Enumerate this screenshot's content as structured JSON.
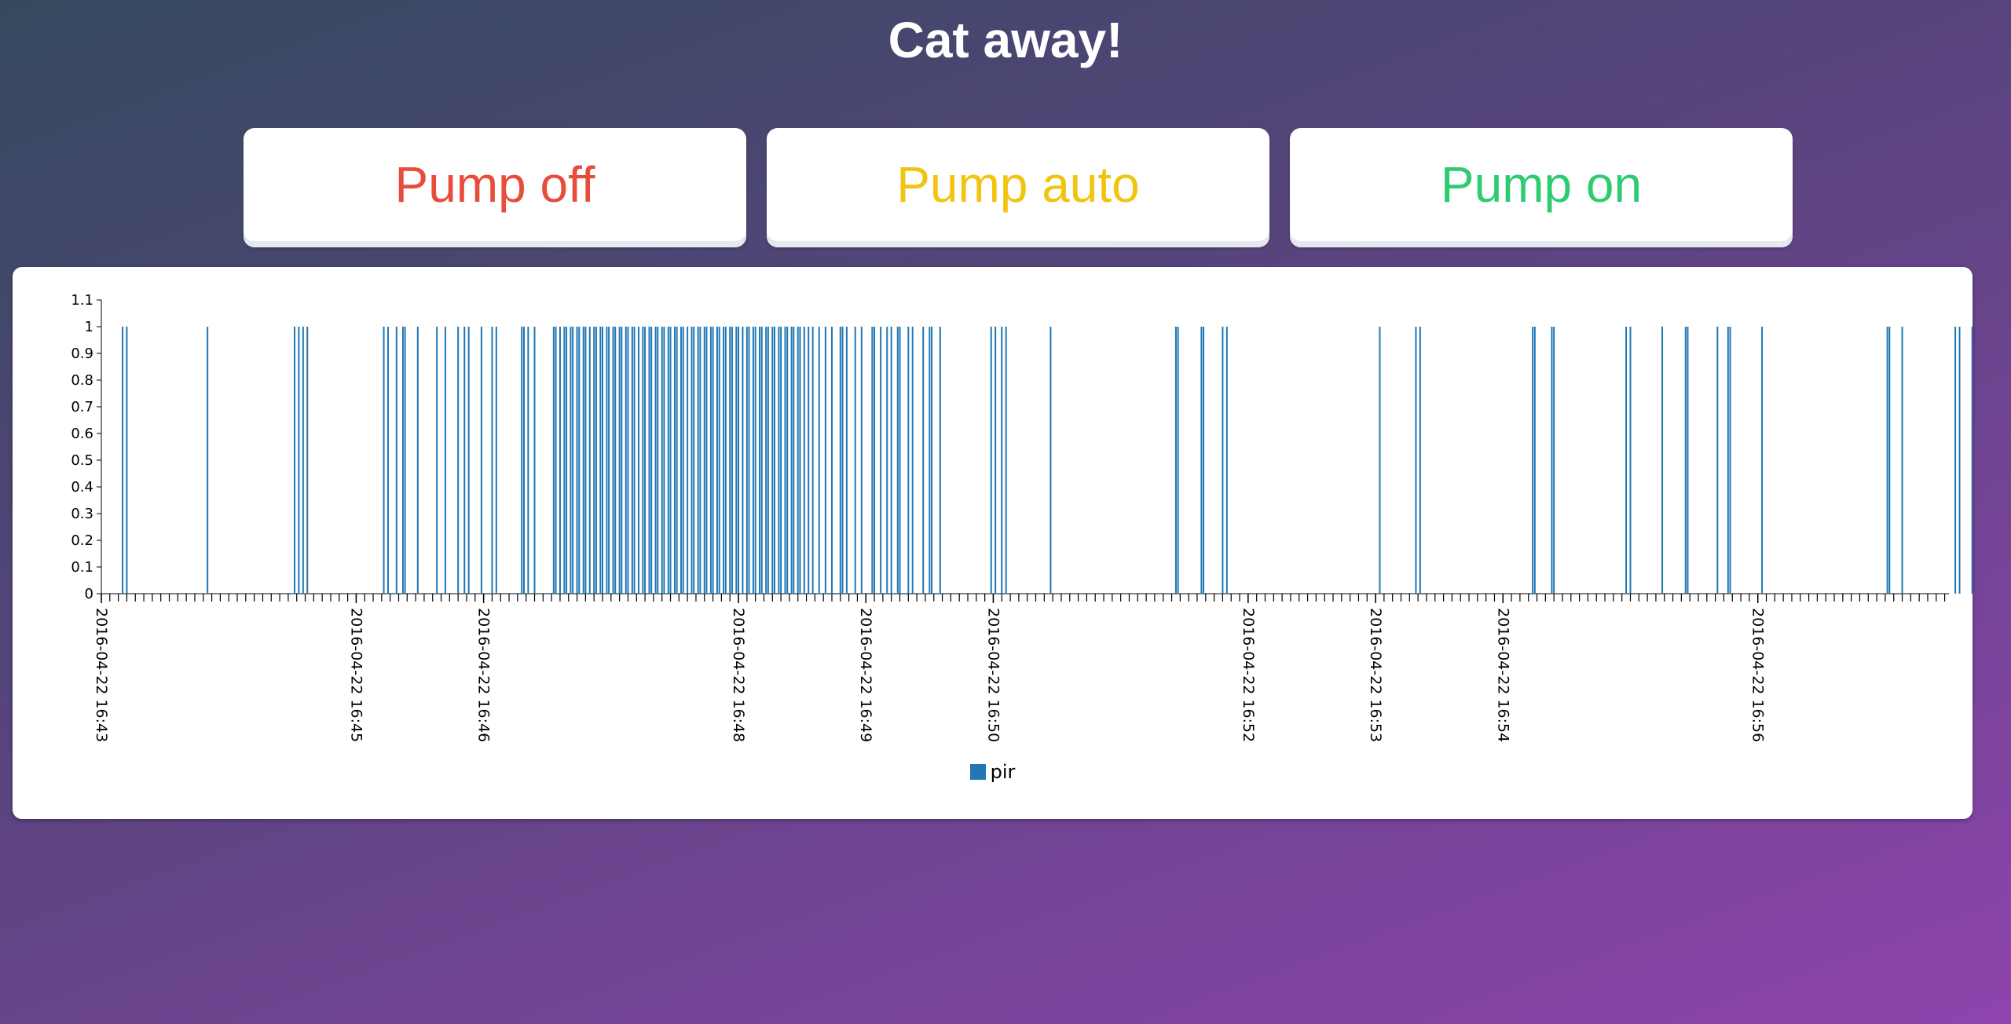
{
  "page": {
    "title": "Cat away!"
  },
  "buttons": [
    {
      "label": "Pump off",
      "color": "#e74c3c"
    },
    {
      "label": "Pump auto",
      "color": "#f1c40f"
    },
    {
      "label": "Pump on",
      "color": "#2ecc71"
    }
  ],
  "chart_data": {
    "type": "bar",
    "title": "",
    "xlabel": "",
    "ylabel": "",
    "ylim": [
      0,
      1.1
    ],
    "y_ticks": [
      0,
      0.1,
      0.2,
      0.3,
      0.4,
      0.5,
      0.6,
      0.7,
      0.8,
      0.9,
      1,
      1.1
    ],
    "x_tick_labels": [
      "2016-04-22 16:43",
      "2016-04-22 16:45",
      "2016-04-22 16:46",
      "2016-04-22 16:48",
      "2016-04-22 16:49",
      "2016-04-22 16:50",
      "2016-04-22 16:52",
      "2016-04-22 16:53",
      "2016-04-22 16:54",
      "2016-04-22 16:56"
    ],
    "x_tick_times": [
      "16:43:00",
      "16:45:00",
      "16:46:00",
      "16:48:00",
      "16:49:00",
      "16:50:00",
      "16:52:00",
      "16:53:00",
      "16:54:00",
      "16:56:00"
    ],
    "x_range": [
      "16:43:00",
      "16:57:30"
    ],
    "grid": false,
    "legend_position": "bottom-center",
    "series": [
      {
        "name": "pir",
        "color": "#1f77b4",
        "events_value": 1,
        "events": [
          "16:43:10",
          "16:43:12",
          "16:43:50",
          "16:44:31",
          "16:44:33",
          "16:44:35",
          "16:44:37",
          "16:45:13",
          "16:45:15",
          "16:45:19",
          "16:45:22",
          "16:45:23",
          "16:45:29",
          "16:45:38",
          "16:45:42",
          "16:45:48",
          "16:45:51",
          "16:45:53",
          "16:45:59",
          "16:46:04",
          "16:46:06",
          "16:46:18",
          "16:46:19",
          "16:46:21",
          "16:46:24",
          "16:46:33",
          "16:46:34",
          "16:46:36",
          "16:46:38",
          "16:46:39",
          "16:46:41",
          "16:46:42",
          "16:46:44",
          "16:46:45",
          "16:46:47",
          "16:46:48",
          "16:46:50",
          "16:46:52",
          "16:46:53",
          "16:46:55",
          "16:46:56",
          "16:46:58",
          "16:46:59",
          "16:47:01",
          "16:47:02",
          "16:47:04",
          "16:47:05",
          "16:47:07",
          "16:47:08",
          "16:47:10",
          "16:47:11",
          "16:47:13",
          "16:47:15",
          "16:47:16",
          "16:47:18",
          "16:47:19",
          "16:47:21",
          "16:47:22",
          "16:47:24",
          "16:47:25",
          "16:47:27",
          "16:47:28",
          "16:47:30",
          "16:47:31",
          "16:47:33",
          "16:47:34",
          "16:47:36",
          "16:47:38",
          "16:47:39",
          "16:47:41",
          "16:47:42",
          "16:47:44",
          "16:47:45",
          "16:47:47",
          "16:47:48",
          "16:47:50",
          "16:47:51",
          "16:47:53",
          "16:47:54",
          "16:47:56",
          "16:47:57",
          "16:47:59",
          "16:48:00",
          "16:48:02",
          "16:48:04",
          "16:48:05",
          "16:48:07",
          "16:48:08",
          "16:48:10",
          "16:48:11",
          "16:48:13",
          "16:48:14",
          "16:48:16",
          "16:48:17",
          "16:48:19",
          "16:48:20",
          "16:48:22",
          "16:48:23",
          "16:48:25",
          "16:48:26",
          "16:48:28",
          "16:48:29",
          "16:48:31",
          "16:48:33",
          "16:48:35",
          "16:48:38",
          "16:48:41",
          "16:48:44",
          "16:48:48",
          "16:48:49",
          "16:48:51",
          "16:48:55",
          "16:48:58",
          "16:49:03",
          "16:49:04",
          "16:49:07",
          "16:49:10",
          "16:49:12",
          "16:49:15",
          "16:49:16",
          "16:49:20",
          "16:49:22",
          "16:49:27",
          "16:49:30",
          "16:49:31",
          "16:49:35",
          "16:49:59",
          "16:50:01",
          "16:50:04",
          "16:50:06",
          "16:50:27",
          "16:51:26",
          "16:51:27",
          "16:51:38",
          "16:51:39",
          "16:51:48",
          "16:51:50",
          "16:53:02",
          "16:53:19",
          "16:53:21",
          "16:54:14",
          "16:54:15",
          "16:54:23",
          "16:54:24",
          "16:54:58",
          "16:55:00",
          "16:55:15",
          "16:55:26",
          "16:55:27",
          "16:55:41",
          "16:55:46",
          "16:55:47",
          "16:56:02",
          "16:57:01",
          "16:57:02",
          "16:57:08",
          "16:57:33",
          "16:57:35",
          "16:57:41"
        ]
      }
    ]
  }
}
